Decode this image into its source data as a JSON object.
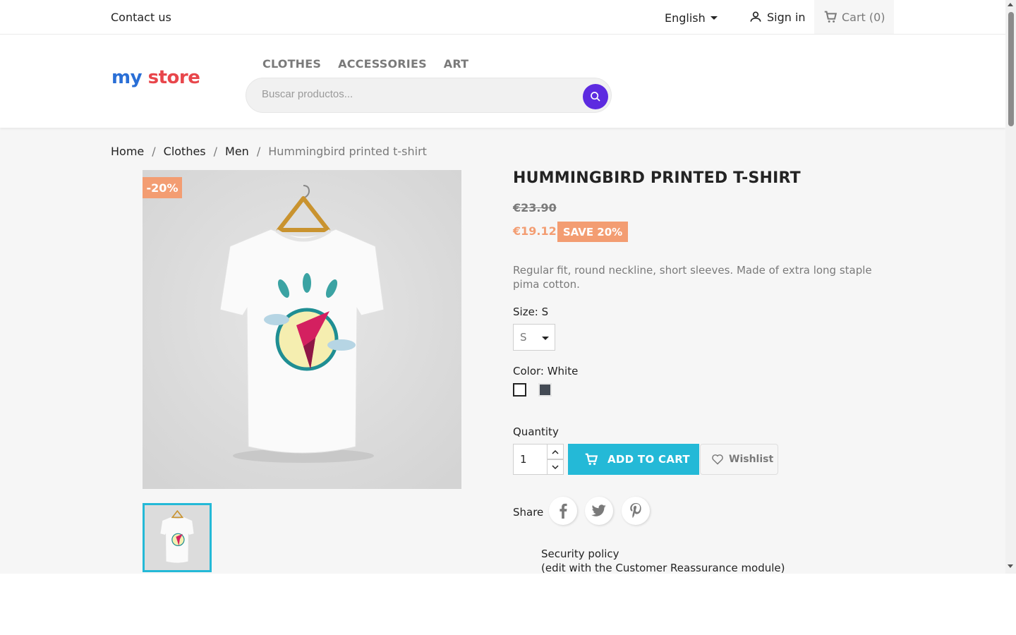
{
  "topnav": {
    "contact_label": "Contact us",
    "language_label": "English",
    "signin_label": "Sign in",
    "cart_label": "Cart",
    "cart_count": "(0)"
  },
  "header": {
    "logo_text_my": "my",
    "logo_text_store": "store",
    "menu": [
      "CLOTHES",
      "ACCESSORIES",
      "ART"
    ],
    "search_placeholder": "Buscar productos..."
  },
  "breadcrumb": [
    "Home",
    "Clothes",
    "Men",
    "Hummingbird printed t-shirt"
  ],
  "product": {
    "discount_badge": "-20%",
    "title": "HUMMINGBIRD PRINTED T-SHIRT",
    "regular_price": "€23.90",
    "price": "€19.12",
    "save_label": "SAVE 20%",
    "description": "Regular fit, round neckline, short sleeves. Made of extra long staple pima cotton.",
    "size_label": "Size: S",
    "size_value": "S",
    "color_label": "Color: White",
    "colors": [
      {
        "name": "White",
        "hex": "#ffffff"
      },
      {
        "name": "Gray",
        "hex": "#434a54"
      }
    ],
    "quantity_label": "Quantity",
    "quantity_value": "1",
    "add_to_cart_label": "ADD TO CART",
    "wishlist_label": "Wishlist",
    "share_label": "Share",
    "share_networks": [
      "facebook",
      "twitter",
      "pinterest"
    ],
    "reassurance_title": "Security policy",
    "reassurance_sub": "(edit with the Customer Reassurance module)"
  },
  "colors": {
    "accent": "#24b9d7",
    "sale": "#f39d72",
    "search_button": "#5d2be0"
  }
}
